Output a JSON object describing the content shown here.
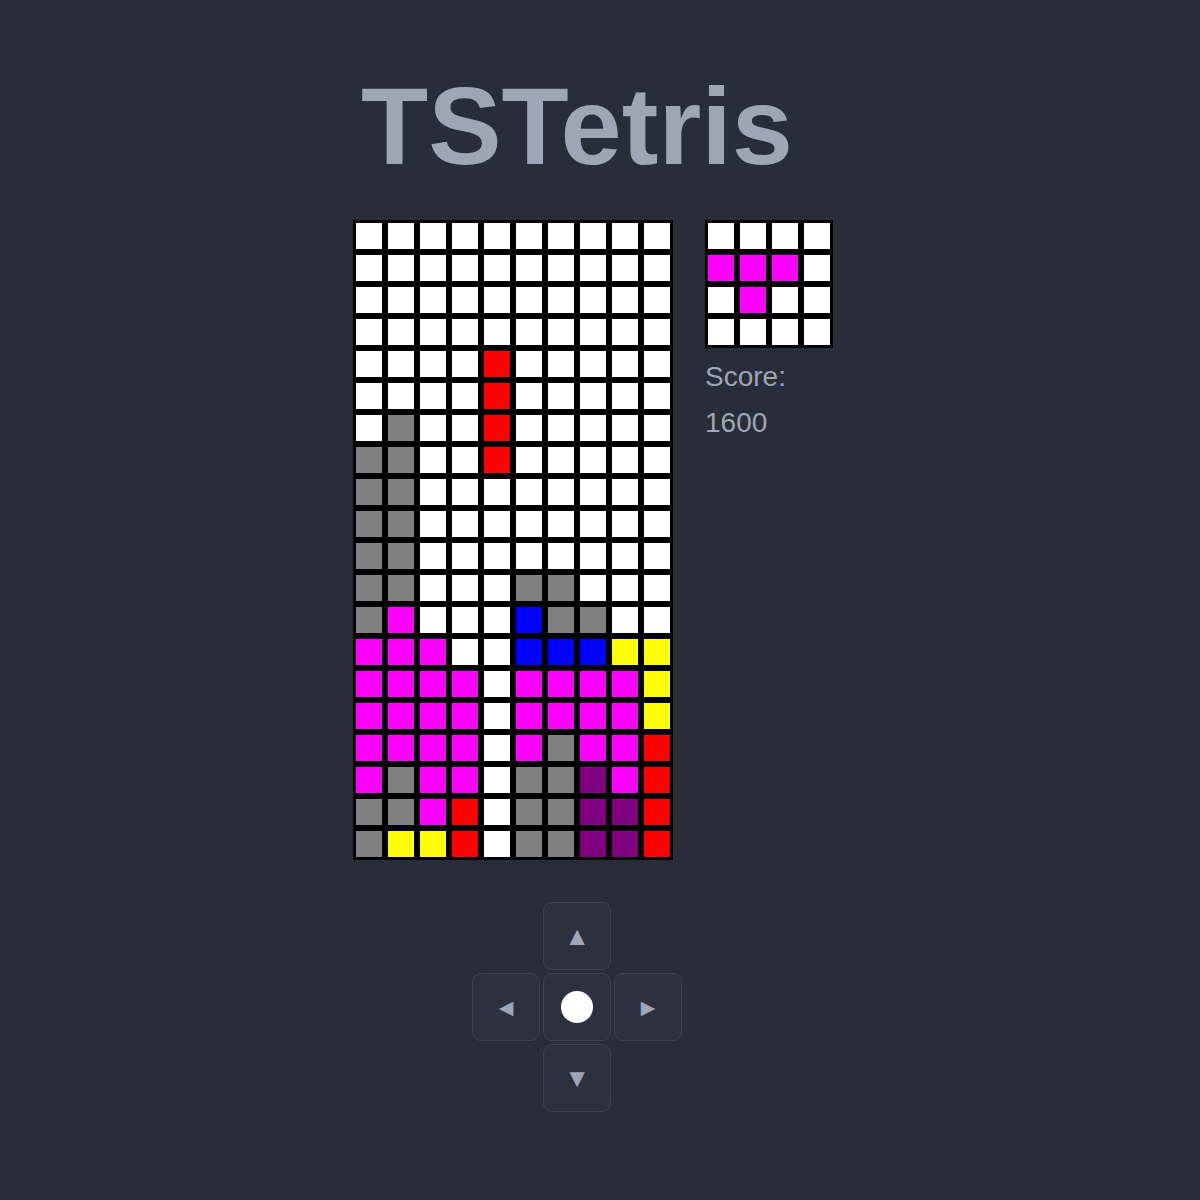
{
  "title": "TSTetris",
  "board": {
    "rows": [
      [
        "#ffffff",
        "#ffffff",
        "#ffffff",
        "#ffffff",
        "#ffffff",
        "#ffffff",
        "#ffffff",
        "#ffffff",
        "#ffffff",
        "#ffffff"
      ],
      [
        "#ffffff",
        "#ffffff",
        "#ffffff",
        "#ffffff",
        "#ffffff",
        "#ffffff",
        "#ffffff",
        "#ffffff",
        "#ffffff",
        "#ffffff"
      ],
      [
        "#ffffff",
        "#ffffff",
        "#ffffff",
        "#ffffff",
        "#ffffff",
        "#ffffff",
        "#ffffff",
        "#ffffff",
        "#ffffff",
        "#ffffff"
      ],
      [
        "#ffffff",
        "#ffffff",
        "#ffffff",
        "#ffffff",
        "#ffffff",
        "#ffffff",
        "#ffffff",
        "#ffffff",
        "#ffffff",
        "#ffffff"
      ],
      [
        "#ffffff",
        "#ffffff",
        "#ffffff",
        "#ffffff",
        "#ff0000",
        "#ffffff",
        "#ffffff",
        "#ffffff",
        "#ffffff",
        "#ffffff"
      ],
      [
        "#ffffff",
        "#ffffff",
        "#ffffff",
        "#ffffff",
        "#ff0000",
        "#ffffff",
        "#ffffff",
        "#ffffff",
        "#ffffff",
        "#ffffff"
      ],
      [
        "#ffffff",
        "#808080",
        "#ffffff",
        "#ffffff",
        "#ff0000",
        "#ffffff",
        "#ffffff",
        "#ffffff",
        "#ffffff",
        "#ffffff"
      ],
      [
        "#808080",
        "#808080",
        "#ffffff",
        "#ffffff",
        "#ff0000",
        "#ffffff",
        "#ffffff",
        "#ffffff",
        "#ffffff",
        "#ffffff"
      ],
      [
        "#808080",
        "#808080",
        "#ffffff",
        "#ffffff",
        "#ffffff",
        "#ffffff",
        "#ffffff",
        "#ffffff",
        "#ffffff",
        "#ffffff"
      ],
      [
        "#808080",
        "#808080",
        "#ffffff",
        "#ffffff",
        "#ffffff",
        "#ffffff",
        "#ffffff",
        "#ffffff",
        "#ffffff",
        "#ffffff"
      ],
      [
        "#808080",
        "#808080",
        "#ffffff",
        "#ffffff",
        "#ffffff",
        "#ffffff",
        "#ffffff",
        "#ffffff",
        "#ffffff",
        "#ffffff"
      ],
      [
        "#808080",
        "#808080",
        "#ffffff",
        "#ffffff",
        "#ffffff",
        "#808080",
        "#808080",
        "#ffffff",
        "#ffffff",
        "#ffffff"
      ],
      [
        "#808080",
        "#ff00ff",
        "#ffffff",
        "#ffffff",
        "#ffffff",
        "#0000ff",
        "#808080",
        "#808080",
        "#ffffff",
        "#ffffff"
      ],
      [
        "#ff00ff",
        "#ff00ff",
        "#ff00ff",
        "#ffffff",
        "#ffffff",
        "#0000ff",
        "#0000ff",
        "#0000ff",
        "#ffff00",
        "#ffff00"
      ],
      [
        "#ff00ff",
        "#ff00ff",
        "#ff00ff",
        "#ff00ff",
        "#ffffff",
        "#ff00ff",
        "#ff00ff",
        "#ff00ff",
        "#ff00ff",
        "#ffff00"
      ],
      [
        "#ff00ff",
        "#ff00ff",
        "#ff00ff",
        "#ff00ff",
        "#ffffff",
        "#ff00ff",
        "#ff00ff",
        "#ff00ff",
        "#ff00ff",
        "#ffff00"
      ],
      [
        "#ff00ff",
        "#ff00ff",
        "#ff00ff",
        "#ff00ff",
        "#ffffff",
        "#ff00ff",
        "#808080",
        "#ff00ff",
        "#ff00ff",
        "#ff0000"
      ],
      [
        "#ff00ff",
        "#808080",
        "#ff00ff",
        "#ff00ff",
        "#ffffff",
        "#808080",
        "#808080",
        "#800080",
        "#ff00ff",
        "#ff0000"
      ],
      [
        "#808080",
        "#808080",
        "#ff00ff",
        "#ff0000",
        "#ffffff",
        "#808080",
        "#808080",
        "#800080",
        "#800080",
        "#ff0000"
      ],
      [
        "#808080",
        "#ffff00",
        "#ffff00",
        "#ff0000",
        "#ffffff",
        "#808080",
        "#808080",
        "#800080",
        "#800080",
        "#ff0000"
      ]
    ]
  },
  "next_piece": {
    "rows": [
      [
        "#ffffff",
        "#ffffff",
        "#ffffff",
        "#ffffff"
      ],
      [
        "#ff00ff",
        "#ff00ff",
        "#ff00ff",
        "#ffffff"
      ],
      [
        "#ffffff",
        "#ff00ff",
        "#ffffff",
        "#ffffff"
      ],
      [
        "#ffffff",
        "#ffffff",
        "#ffffff",
        "#ffffff"
      ]
    ]
  },
  "score": {
    "label": "Score:",
    "value": "1600"
  },
  "controls": {
    "up": "▲",
    "left": "◀",
    "right": "▶",
    "down": "▼"
  }
}
